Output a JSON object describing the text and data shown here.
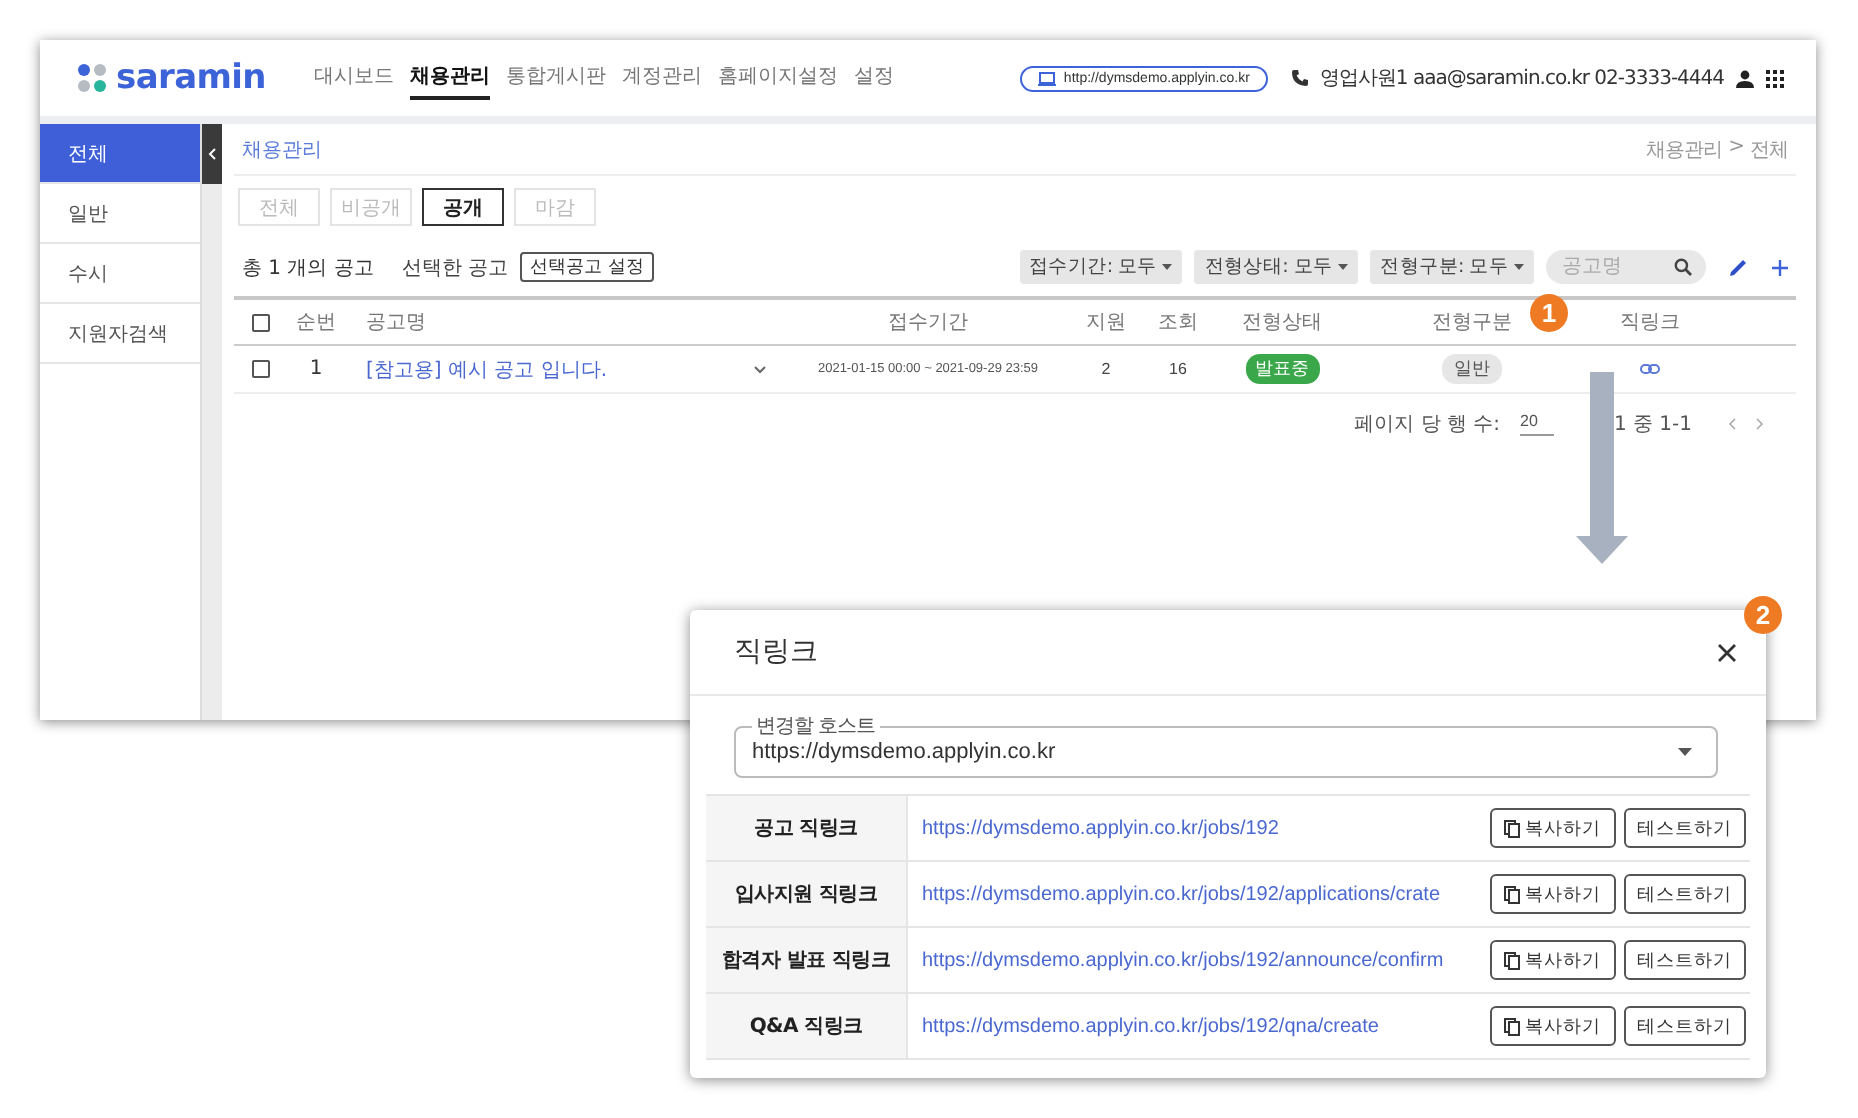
{
  "header": {
    "logo": "saramin",
    "nav": [
      {
        "label": "대시보드",
        "selected": false
      },
      {
        "label": "채용관리",
        "selected": true
      },
      {
        "label": "통합게시판",
        "selected": false
      },
      {
        "label": "계정관리",
        "selected": false
      },
      {
        "label": "홈페이지설정",
        "selected": false
      },
      {
        "label": "설정",
        "selected": false
      }
    ],
    "site_url": "http://dymsdemo.applyin.co.kr",
    "contact": "영업사원1 aaa@saramin.co.kr 02-3333-4444"
  },
  "sidebar": {
    "items": [
      {
        "label": "전체",
        "selected": true
      },
      {
        "label": "일반",
        "selected": false
      },
      {
        "label": "수시",
        "selected": false
      },
      {
        "label": "지원자검색",
        "selected": false
      }
    ]
  },
  "page": {
    "title": "채용관리",
    "breadcrumb": [
      "채용관리",
      "전체"
    ],
    "breadcrumb_separator": ">"
  },
  "tabs": [
    {
      "label": "전체",
      "selected": false
    },
    {
      "label": "비공개",
      "selected": false
    },
    {
      "label": "공개",
      "selected": true
    },
    {
      "label": "마감",
      "selected": false
    }
  ],
  "toolbar": {
    "summary": "총 1 개의 공고",
    "selected_label": "선택한 공고",
    "selected_button": "선택공고 설정",
    "filters": [
      "접수기간: 모두",
      "전형상태: 모두",
      "전형구분: 모두"
    ],
    "search": {
      "placeholder": "공고명"
    }
  },
  "table": {
    "header_checked": false,
    "columns": [
      "순번",
      "공고명",
      "접수기간",
      "지원",
      "조회",
      "전형상태",
      "전형구분",
      "직링크"
    ],
    "rows": [
      {
        "checked": false,
        "number": "1",
        "title": "[참고용] 예시 공고 입니다.",
        "period": "2021-01-15 00:00 ~ 2021-09-29 23:59",
        "applicants": "2",
        "views": "16",
        "status": "발표중",
        "type": "일반"
      }
    ]
  },
  "pagination": {
    "rows_label": "페이지 당 행 수:",
    "rows_value": "20",
    "range": "1 중 1-1"
  },
  "callouts": [
    "1",
    "2"
  ],
  "dialog": {
    "title": "직링크",
    "host": {
      "label": "변경할 호스트",
      "value": "https://dymsdemo.applyin.co.kr"
    },
    "links": [
      {
        "label": "공고 직링크",
        "url": "https://dymsdemo.applyin.co.kr/jobs/192",
        "copy": "복사하기",
        "test": "테스트하기"
      },
      {
        "label": "입사지원 직링크",
        "url": "https://dymsdemo.applyin.co.kr/jobs/192/applications/crate",
        "copy": "복사하기",
        "test": "테스트하기"
      },
      {
        "label": "합격자 발표 직링크",
        "url": "https://dymsdemo.applyin.co.kr/jobs/192/announce/confirm",
        "copy": "복사하기",
        "test": "테스트하기"
      },
      {
        "label": "Q&A 직링크",
        "url": "https://dymsdemo.applyin.co.kr/jobs/192/qna/create",
        "copy": "복사하기",
        "test": "테스트하기"
      }
    ]
  }
}
